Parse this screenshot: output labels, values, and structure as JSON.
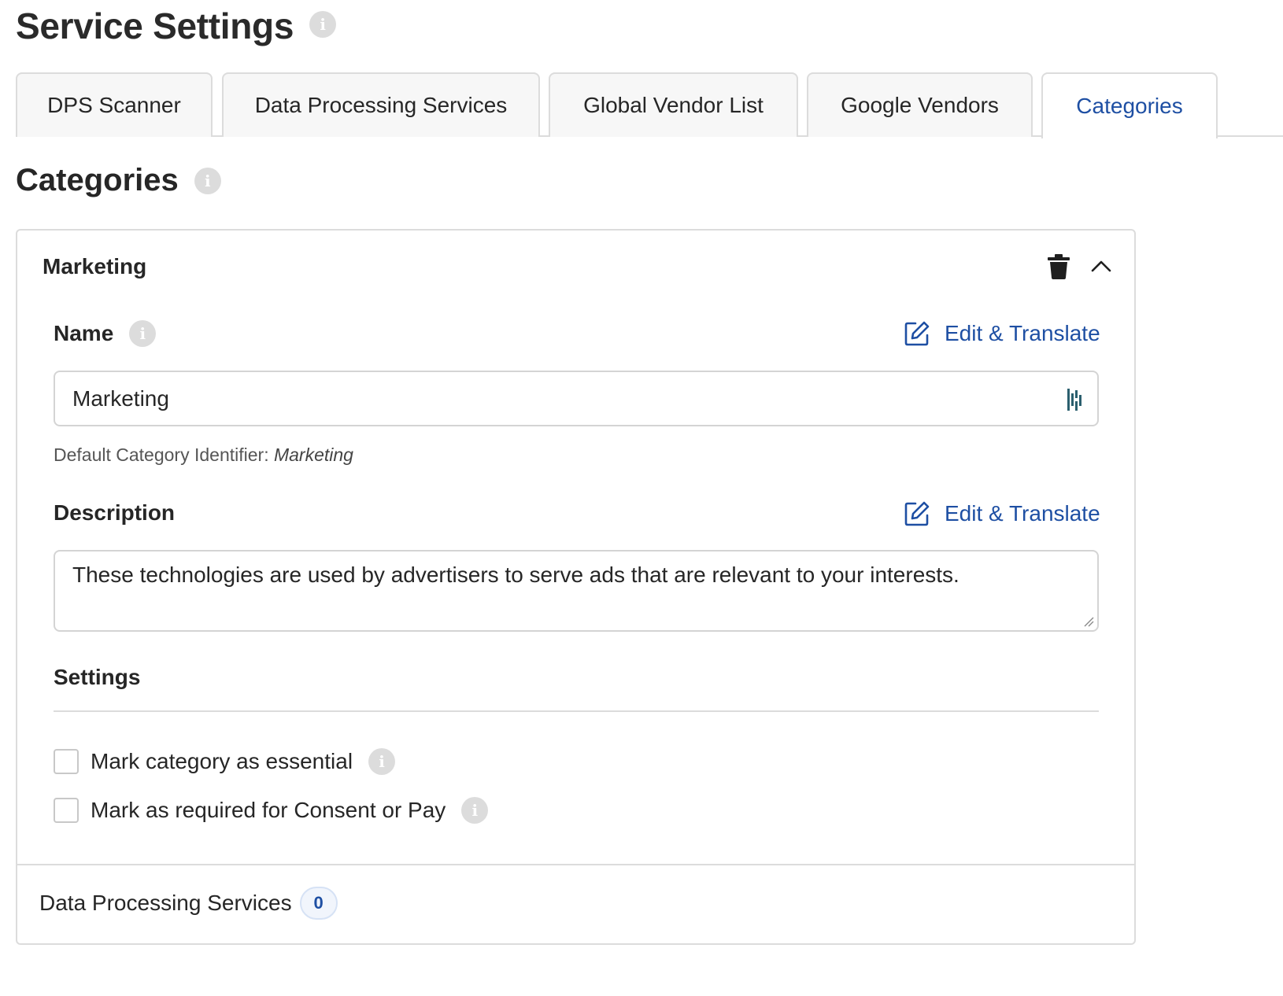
{
  "page": {
    "title": "Service Settings",
    "info_glyph": "i"
  },
  "tabs": [
    {
      "label": "DPS Scanner",
      "active": false
    },
    {
      "label": "Data Processing Services",
      "active": false
    },
    {
      "label": "Global Vendor List",
      "active": false
    },
    {
      "label": "Google Vendors",
      "active": false
    },
    {
      "label": "Categories",
      "active": true
    }
  ],
  "section": {
    "title": "Categories"
  },
  "category": {
    "title": "Marketing",
    "actions": {
      "delete_icon": "trash-icon",
      "collapse_icon": "chevron-up-icon"
    },
    "name_field": {
      "label": "Name",
      "edit_link": "Edit & Translate",
      "value": "Marketing",
      "helper_prefix": "Default Category Identifier:",
      "helper_value": "Marketing"
    },
    "description_field": {
      "label": "Description",
      "edit_link": "Edit & Translate",
      "value": "These technologies are used by advertisers to serve ads that are relevant to your interests."
    },
    "settings": {
      "label": "Settings",
      "options": [
        {
          "label": "Mark category as essential",
          "checked": false
        },
        {
          "label": "Mark as required for Consent or Pay",
          "checked": false
        }
      ]
    },
    "dps": {
      "label": "Data Processing Services",
      "count": "0"
    }
  },
  "colors": {
    "accent": "#1e4fa3",
    "border": "#dcdcdc",
    "info_icon_bg": "#dcdcdc",
    "input_addon_icon": "#2b5f6e"
  }
}
